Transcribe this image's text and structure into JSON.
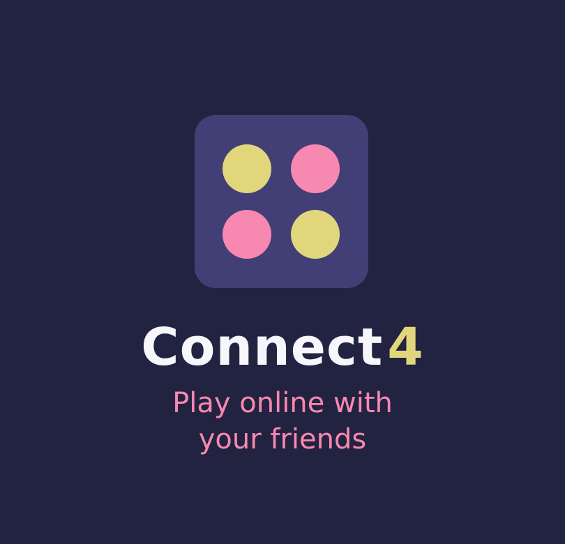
{
  "colors": {
    "background": "#222341",
    "tile": "#413f76",
    "yellow": "#e1d67c",
    "pink": "#f788b0",
    "title_text": "#f7f6fb"
  },
  "logo": {
    "icon": "connect-four-discs-icon",
    "discs": [
      {
        "position": "top-left",
        "color": "yellow"
      },
      {
        "position": "top-right",
        "color": "pink"
      },
      {
        "position": "bottom-left",
        "color": "pink"
      },
      {
        "position": "bottom-right",
        "color": "yellow"
      }
    ]
  },
  "title": {
    "word": "Connect",
    "number": "4"
  },
  "subtitle": {
    "line1": "Play online with",
    "line2": "your friends"
  }
}
